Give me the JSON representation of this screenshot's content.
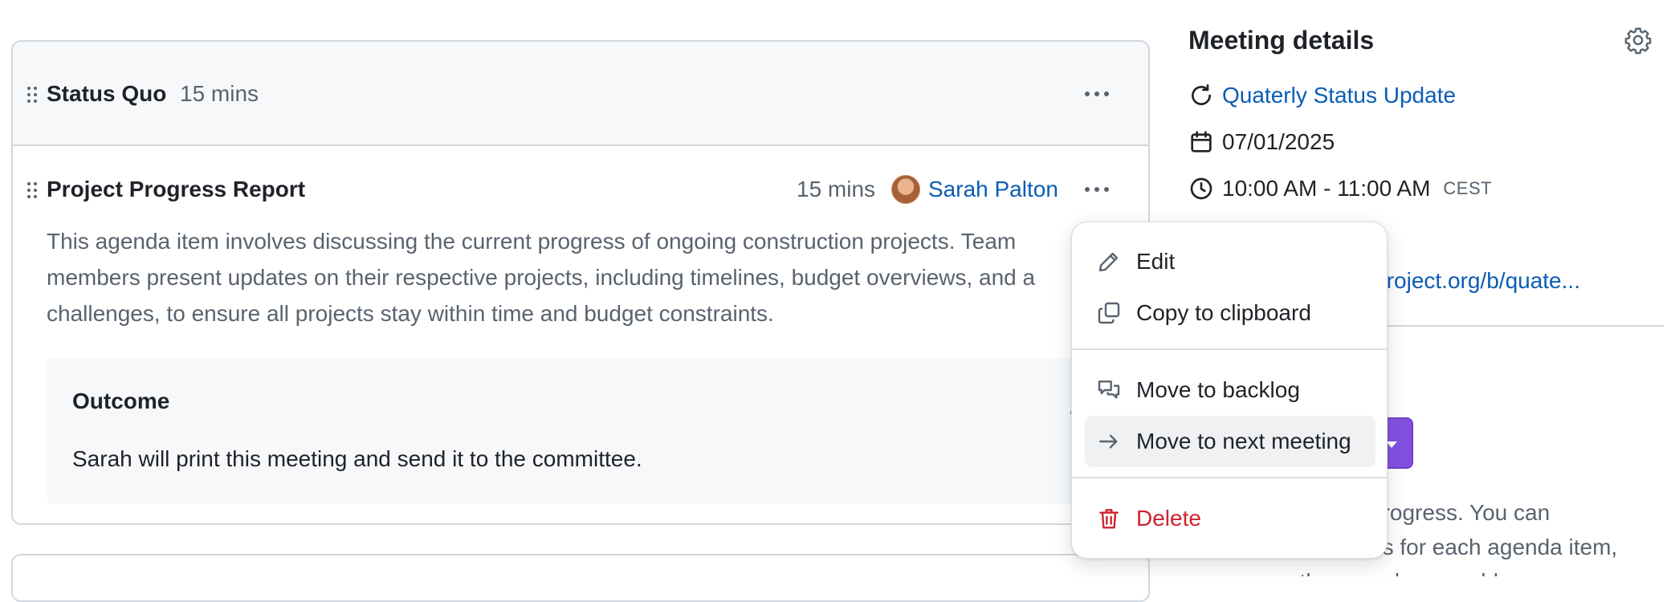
{
  "agenda": {
    "section": {
      "title": "Status Quo",
      "duration": "15 mins"
    },
    "item": {
      "title": "Project Progress Report",
      "duration": "15 mins",
      "presenter": "Sarah Palton",
      "description_lines": [
        "This agenda item involves discussing the current progress of ongoing construction projects. Team",
        "members present updates on their respective projects, including timelines, budget overviews, and a",
        "challenges, to ensure all projects stay within time and budget constraints."
      ],
      "outcome": {
        "title": "Outcome",
        "text": "Sarah will print this meeting and send it to the committee."
      }
    }
  },
  "details": {
    "title": "Meeting details",
    "series_link": "Quaterly Status Update",
    "date": "07/01/2025",
    "time": "10:00 AM - 11:00 AM",
    "timezone": "CEST",
    "url_fragment": "enproject.org/b/quate...",
    "help_lines": [
      "progress. You can",
      "es for each agenda item,",
      "re-arrange them, and even add new ones"
    ]
  },
  "menu": {
    "items": [
      {
        "label": "Edit",
        "icon": "pencil-icon"
      },
      {
        "label": "Copy to clipboard",
        "icon": "copy-icon"
      },
      {
        "label": "Move to backlog",
        "icon": "backlog-icon"
      },
      {
        "label": "Move to next meeting",
        "icon": "arrow-right-icon",
        "highlighted": true
      },
      {
        "label": "Delete",
        "icon": "trash-icon",
        "danger": true
      }
    ]
  },
  "colors": {
    "link": "#0a5cb5",
    "danger": "#cf222e",
    "primary_button": "#8250df",
    "muted_text": "#59636e"
  }
}
